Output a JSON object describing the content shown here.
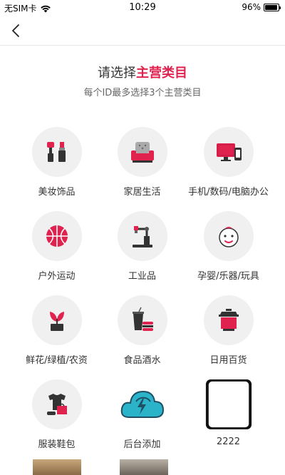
{
  "status_bar": {
    "carrier": "无SIM卡",
    "time": "10:29",
    "battery": "96%",
    "battery_level": 0.96
  },
  "nav": {
    "back_icon": "chevron-left-icon"
  },
  "heading": {
    "prefix": "请选择",
    "highlight": "主营类目"
  },
  "subheading": "每个ID最多选择3个主营类目",
  "colors": {
    "accent": "#e0224f",
    "icon_bg": "#f0f0f0",
    "text": "#333333"
  },
  "categories": [
    {
      "label": "美妆饰品",
      "icon": "cosmetics-icon"
    },
    {
      "label": "家居生活",
      "icon": "sofa-icon"
    },
    {
      "label": "手机/数码/电脑办公",
      "icon": "computer-icon"
    },
    {
      "label": "户外运动",
      "icon": "basketball-icon"
    },
    {
      "label": "工业品",
      "icon": "robot-arm-icon"
    },
    {
      "label": "孕婴/乐器/玩具",
      "icon": "baby-face-icon"
    },
    {
      "label": "鲜花/绿植/农资",
      "icon": "potted-plant-icon"
    },
    {
      "label": "食品酒水",
      "icon": "food-drink-icon"
    },
    {
      "label": "日用百货",
      "icon": "cooking-pot-icon"
    },
    {
      "label": "服装鞋包",
      "icon": "clothing-icon"
    },
    {
      "label": "后台添加",
      "icon": "cloud-icon"
    },
    {
      "label": "2222",
      "icon": "phone-image-icon"
    }
  ]
}
